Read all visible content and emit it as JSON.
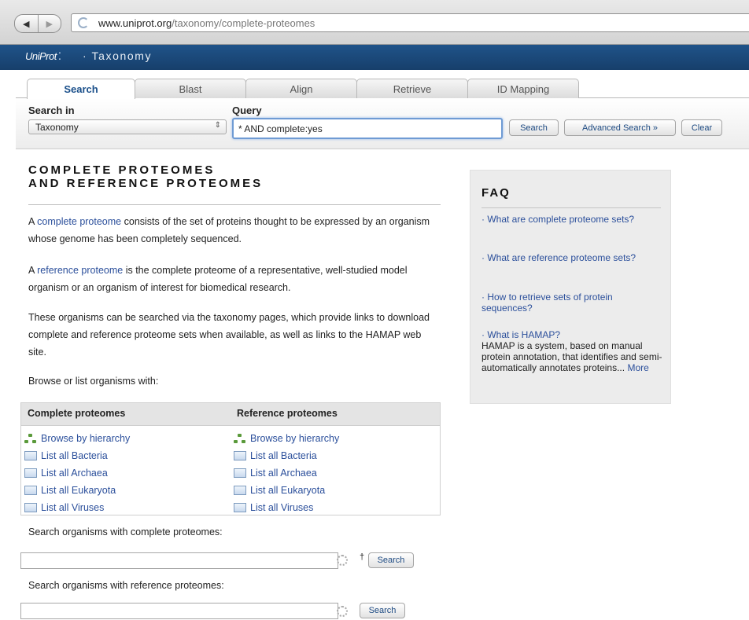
{
  "browser": {
    "url_domain": "www.uniprot.org",
    "url_path": "/taxonomy/complete-proteomes",
    "back": "◀",
    "forward": "▶"
  },
  "header": {
    "logo": "UniProt",
    "section": "· Taxonomy"
  },
  "tabs": [
    "Search",
    "Blast",
    "Align",
    "Retrieve",
    "ID Mapping"
  ],
  "search": {
    "search_in_label": "Search in",
    "search_in_value": "Taxonomy",
    "query_label": "Query",
    "query_value": "* AND complete:yes",
    "search_button": "Search",
    "advanced_button": "Advanced Search »",
    "clear_button": "Clear"
  },
  "main": {
    "title_line1": "COMPLETE PROTEOMES",
    "title_line2": "AND REFERENCE PROTEOMES",
    "p1_prefix": "A ",
    "p1_link": "complete proteome",
    "p1_rest": " consists of the set of proteins thought to be expressed by an organism whose genome has been completely sequenced.",
    "p2_prefix": "A ",
    "p2_link": "reference proteome",
    "p2_rest": " is the complete proteome of a representative, well-studied model organism or an organism of interest for biomedical research.",
    "p3": "These organisms can be searched via the taxonomy pages, which provide links to download complete and reference proteome sets when available, as well as links to the HAMAP web site.",
    "browse_label": "Browse or list organisms with:"
  },
  "table": {
    "col1_header": "Complete proteomes",
    "col2_header": "Reference proteomes",
    "links": [
      "Browse by hierarchy",
      "List all Bacteria",
      "List all Archaea",
      "List all Eukaryota",
      "List all Viruses"
    ]
  },
  "search_complete": {
    "label": "Search organisms with complete proteomes:",
    "mark": "†",
    "button": "Search"
  },
  "search_reference": {
    "label": "Search organisms with reference proteomes:",
    "button": "Search"
  },
  "faq": {
    "title": "FAQ",
    "q1": "· What are complete proteome sets?",
    "q2": "· What are reference proteome sets?",
    "q3": "· How to retrieve sets of protein sequences?",
    "q4": "· What is HAMAP?",
    "q4_desc": "HAMAP is a system, based on manual protein annotation, that identifies and semi-automatically annotates proteins...",
    "more": "More"
  }
}
